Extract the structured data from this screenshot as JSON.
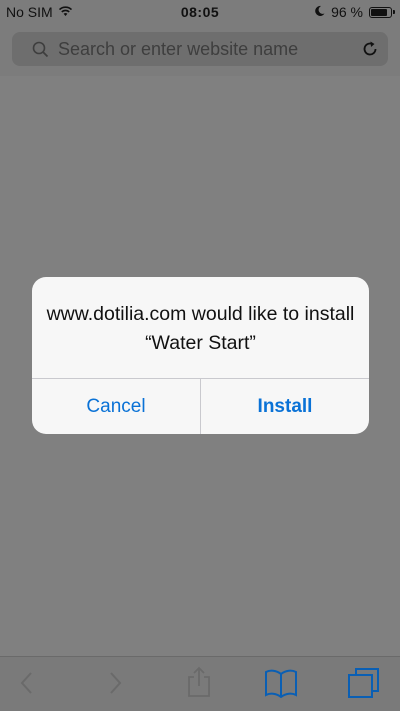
{
  "status_bar": {
    "carrier": "No SIM",
    "time": "08:05",
    "battery_text": "96 %",
    "battery_level": 0.96,
    "icons": [
      "wifi-icon",
      "moon-icon",
      "battery-icon"
    ]
  },
  "address_bar": {
    "placeholder": "Search or enter website name",
    "icons": [
      "search-icon",
      "reload-icon"
    ]
  },
  "dialog": {
    "message": "www.dotilia.com would like to install “Water Start”",
    "cancel_label": "Cancel",
    "install_label": "Install"
  },
  "toolbar": {
    "icons": [
      "back-icon",
      "forward-icon",
      "share-icon",
      "bookmarks-icon",
      "tabs-icon"
    ]
  },
  "colors": {
    "accent": "#0a72d6",
    "dim_overlay": "#808080",
    "dialog_bg": "#f7f7f7"
  }
}
